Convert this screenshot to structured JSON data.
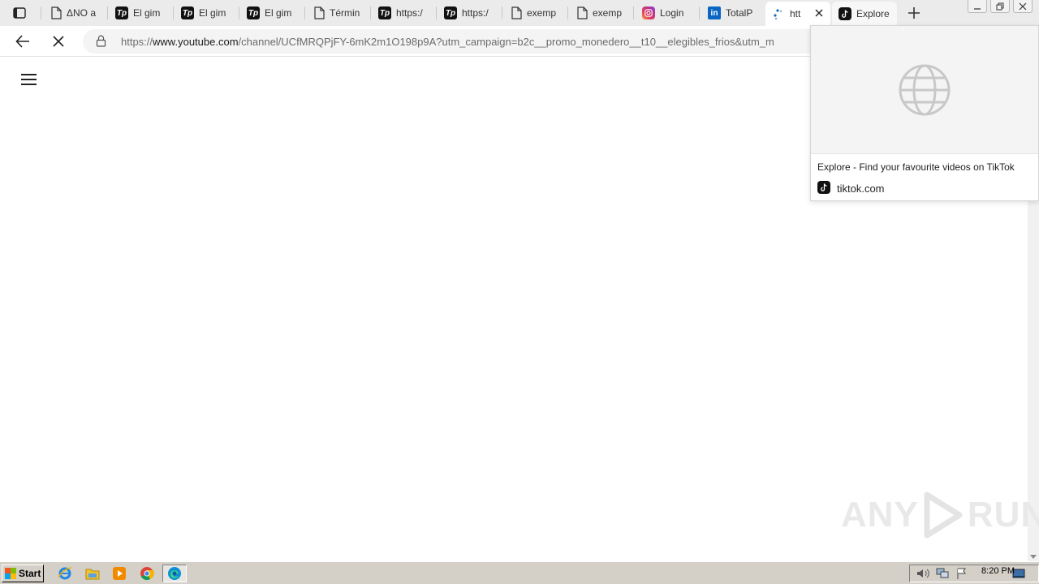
{
  "tabs": [
    {
      "title": "ΔNO a",
      "favicon": "document-icon"
    },
    {
      "title": "El gim",
      "favicon": "totalplay-icon"
    },
    {
      "title": "El gim",
      "favicon": "totalplay-icon"
    },
    {
      "title": "El gim",
      "favicon": "totalplay-icon"
    },
    {
      "title": "Términ",
      "favicon": "document-icon"
    },
    {
      "title": "https:/",
      "favicon": "totalplay-icon"
    },
    {
      "title": "https:/",
      "favicon": "totalplay-icon"
    },
    {
      "title": "exemp",
      "favicon": "document-icon"
    },
    {
      "title": "exemp",
      "favicon": "document-icon"
    },
    {
      "title": "Login",
      "favicon": "instagram-icon"
    },
    {
      "title": "TotalP",
      "favicon": "linkedin-icon"
    },
    {
      "title": "htt",
      "favicon": "loading-icon",
      "active": true
    },
    {
      "title": "Explore",
      "favicon": "tiktok-icon",
      "hovered": true
    }
  ],
  "address_bar": {
    "scheme": "https://",
    "host": "www.youtube.com",
    "path": "/channel/UCfMRQPjFY-6mK2m1O198p9A?utm_campaign=b2c__promo_monedero__t10__elegibles_frios&utm_m"
  },
  "hover_card": {
    "title": "Explore - Find your favourite videos on TikTok",
    "domain": "tiktok.com"
  },
  "watermark": {
    "left": "ANY",
    "right": "RUN"
  },
  "taskbar": {
    "start_label": "Start",
    "clock": "8:20 PM"
  },
  "colors": {
    "tabstrip_bg": "#ebebeb",
    "taskbar_bg": "#d4d0c8",
    "linkedin": "#0a66c2"
  }
}
